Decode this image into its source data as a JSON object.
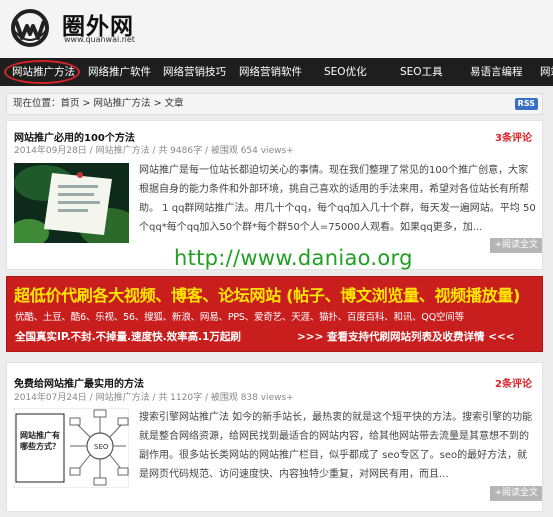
{
  "site": {
    "name": "圈外网",
    "url": "www.quanwai.net"
  },
  "nav": {
    "items": [
      "网站推广方法",
      "网络推广软件",
      "网络营销技巧",
      "网络营销软件",
      "SEO优化",
      "SEO工具",
      "易语言编程",
      "网站"
    ]
  },
  "breadcrumb": {
    "prefix": "现在位置：",
    "home": "首页",
    "sep1": " > ",
    "category": "网站推广方法",
    "sep2": " > ",
    "current": "文章",
    "rss": "RSS"
  },
  "watermark": "http://www.daniao.org",
  "articles": [
    {
      "title": "网站推广必用的100个方法",
      "meta": "2014年09月28日 / 网站推广方法 / 共 9486字 / 被围观 654 views+",
      "comments": "3条评论",
      "excerpt": "网站推广是每一位站长都迫切关心的事情。现在我们整理了常见的100个推广创意，大家根据自身的能力条件和外部环境，挑自己喜欢的适用的手法来用，希望对各位站长有所帮助。 1 qq群网站推广法。用几十个qq，每个qq加入几十个群，每天发一遍网站。平均 50个qq*每个qq加入50个群*每个群50个人=75000人观看。如果qq更多，加...",
      "read_more": "+阅读全文"
    },
    {
      "title": "免费给网站推广最实用的方法",
      "meta": "2014年07月24日 / 网站推广方法 / 共 1120字 / 被围观 838 views+",
      "comments": "2条评论",
      "excerpt": "搜索引擎网站推广法 如今的新手站长，最热衷的就是这个短平快的方法。搜索引擎的功能就是整合网络资源，给网民找到最适合的网站内容，给其他网站带去流量是其意想不到的副作用。很多站长类网站的网站推广栏目，似乎都成了 seo专区了。seo的最好方法，就是网页代码规范、访问速度快、内容独特少重复，对网民有用，而且...",
      "read_more": "+阅读全文",
      "thumb_text": "网站推广有哪些方式？"
    }
  ],
  "ad": {
    "line1": "超低价代刷各大视频、博客、论坛网站 (帖子、博文浏览量、视频播放量)",
    "line2": "优酷、土豆、酷6、乐视、56、搜狐、新浪、网易、PPS、爱奇艺、天涯、猫扑、百度百科、和讯、QQ空间等",
    "line3": "全国真实IP.不封.不掉量.速度快.效率高.1万起刷",
    "line4": ">>> 查看支持代刷网站列表及收费详情 <<<"
  },
  "colors": {
    "nav_bg": "#1e1e1e",
    "accent_red": "#d8232a",
    "ad_bg": "#c91e1e",
    "ad_yellow": "#ffe600",
    "watermark_green": "#20a020"
  }
}
